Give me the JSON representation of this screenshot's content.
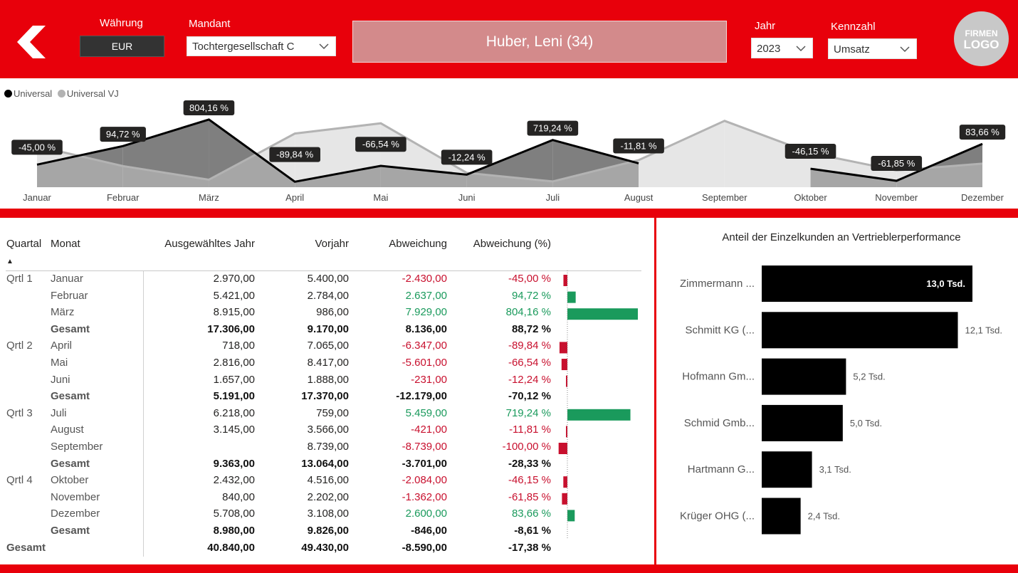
{
  "header": {
    "currency_label": "Währung",
    "currency_value": "EUR",
    "client_label": "Mandant",
    "client_value": "Tochtergesellschaft C",
    "person": "Huber, Leni (34)",
    "year_label": "Jahr",
    "year_value": "2023",
    "metric_label": "Kennzahl",
    "metric_value": "Umsatz",
    "logo_line1": "FIRMEN",
    "logo_line2": "LOGO"
  },
  "colors": {
    "brand_red": "#e8000b",
    "positive": "#1a9a5c",
    "negative": "#c8102e",
    "current_series": "#000000",
    "prior_series": "#b3b3b3"
  },
  "chart_data": [
    {
      "type": "area",
      "legend": [
        "Universal",
        "Universal VJ"
      ],
      "legend_position": "top-left",
      "categories": [
        "Januar",
        "Februar",
        "März",
        "April",
        "Mai",
        "Juni",
        "Juli",
        "August",
        "September",
        "Oktober",
        "November",
        "Dezember"
      ],
      "series": [
        {
          "name": "Universal",
          "values": [
            2970,
            5421,
            8915,
            718,
            2816,
            1657,
            6218,
            3145,
            null,
            2432,
            840,
            5708
          ]
        },
        {
          "name": "Universal VJ",
          "values": [
            5400,
            2784,
            986,
            7065,
            8417,
            1888,
            759,
            3566,
            8739,
            4516,
            2202,
            3108
          ]
        }
      ],
      "data_labels": [
        "-45,00 %",
        "94,72 %",
        "804,16 %",
        "-89,84 %",
        "-66,54 %",
        "-12,24 %",
        "719,24 %",
        "-11,81 %",
        "",
        "-46,15 %",
        "-61,85 %",
        "83,66 %"
      ]
    },
    {
      "type": "bar",
      "orientation": "horizontal",
      "title": "Anteil der Einzelkunden an Vertrieblerperformance",
      "categories": [
        "Zimmermann ...",
        "Schmitt KG (...",
        "Hofmann Gm...",
        "Schmid Gmb...",
        "Hartmann G...",
        "Krüger OHG (..."
      ],
      "values": [
        13.0,
        12.1,
        5.2,
        5.0,
        3.1,
        2.4
      ],
      "labels": [
        "13,0 Tsd.",
        "12,1 Tsd.",
        "5,2 Tsd.",
        "5,0 Tsd.",
        "3,1 Tsd.",
        "2,4 Tsd."
      ]
    }
  ],
  "table": {
    "headers": [
      "Quartal",
      "Monat",
      "Ausgewähltes Jahr",
      "Vorjahr",
      "Abweichung",
      "Abweichung (%)"
    ],
    "sort_indicator": "▲",
    "rows": [
      {
        "q": "Qrtl 1",
        "m": "Januar",
        "cy": "2.970,00",
        "py": "5.400,00",
        "d": "-2.430,00",
        "p": "-45,00 %",
        "pv": -45.0,
        "kind": "row"
      },
      {
        "q": "",
        "m": "Februar",
        "cy": "5.421,00",
        "py": "2.784,00",
        "d": "2.637,00",
        "p": "94,72 %",
        "pv": 94.72,
        "kind": "row"
      },
      {
        "q": "",
        "m": "März",
        "cy": "8.915,00",
        "py": "986,00",
        "d": "7.929,00",
        "p": "804,16 %",
        "pv": 804.16,
        "kind": "row"
      },
      {
        "q": "",
        "m": "Gesamt",
        "cy": "17.306,00",
        "py": "9.170,00",
        "d": "8.136,00",
        "p": "88,72 %",
        "pv": 88.72,
        "kind": "sub"
      },
      {
        "q": "Qrtl 2",
        "m": "April",
        "cy": "718,00",
        "py": "7.065,00",
        "d": "-6.347,00",
        "p": "-89,84 %",
        "pv": -89.84,
        "kind": "row"
      },
      {
        "q": "",
        "m": "Mai",
        "cy": "2.816,00",
        "py": "8.417,00",
        "d": "-5.601,00",
        "p": "-66,54 %",
        "pv": -66.54,
        "kind": "row"
      },
      {
        "q": "",
        "m": "Juni",
        "cy": "1.657,00",
        "py": "1.888,00",
        "d": "-231,00",
        "p": "-12,24 %",
        "pv": -12.24,
        "kind": "row"
      },
      {
        "q": "",
        "m": "Gesamt",
        "cy": "5.191,00",
        "py": "17.370,00",
        "d": "-12.179,00",
        "p": "-70,12 %",
        "pv": -70.12,
        "kind": "sub"
      },
      {
        "q": "Qrtl 3",
        "m": "Juli",
        "cy": "6.218,00",
        "py": "759,00",
        "d": "5.459,00",
        "p": "719,24 %",
        "pv": 719.24,
        "kind": "row"
      },
      {
        "q": "",
        "m": "August",
        "cy": "3.145,00",
        "py": "3.566,00",
        "d": "-421,00",
        "p": "-11,81 %",
        "pv": -11.81,
        "kind": "row"
      },
      {
        "q": "",
        "m": "September",
        "cy": "",
        "py": "8.739,00",
        "d": "-8.739,00",
        "p": "-100,00 %",
        "pv": -100.0,
        "kind": "row"
      },
      {
        "q": "",
        "m": "Gesamt",
        "cy": "9.363,00",
        "py": "13.064,00",
        "d": "-3.701,00",
        "p": "-28,33 %",
        "pv": -28.33,
        "kind": "sub"
      },
      {
        "q": "Qrtl 4",
        "m": "Oktober",
        "cy": "2.432,00",
        "py": "4.516,00",
        "d": "-2.084,00",
        "p": "-46,15 %",
        "pv": -46.15,
        "kind": "row"
      },
      {
        "q": "",
        "m": "November",
        "cy": "840,00",
        "py": "2.202,00",
        "d": "-1.362,00",
        "p": "-61,85 %",
        "pv": -61.85,
        "kind": "row"
      },
      {
        "q": "",
        "m": "Dezember",
        "cy": "5.708,00",
        "py": "3.108,00",
        "d": "2.600,00",
        "p": "83,66 %",
        "pv": 83.66,
        "kind": "row"
      },
      {
        "q": "",
        "m": "Gesamt",
        "cy": "8.980,00",
        "py": "9.826,00",
        "d": "-846,00",
        "p": "-8,61 %",
        "pv": -8.61,
        "kind": "sub"
      },
      {
        "q": "Gesamt",
        "m": "",
        "cy": "40.840,00",
        "py": "49.430,00",
        "d": "-8.590,00",
        "p": "-17,38 %",
        "pv": -17.38,
        "kind": "total"
      }
    ]
  }
}
